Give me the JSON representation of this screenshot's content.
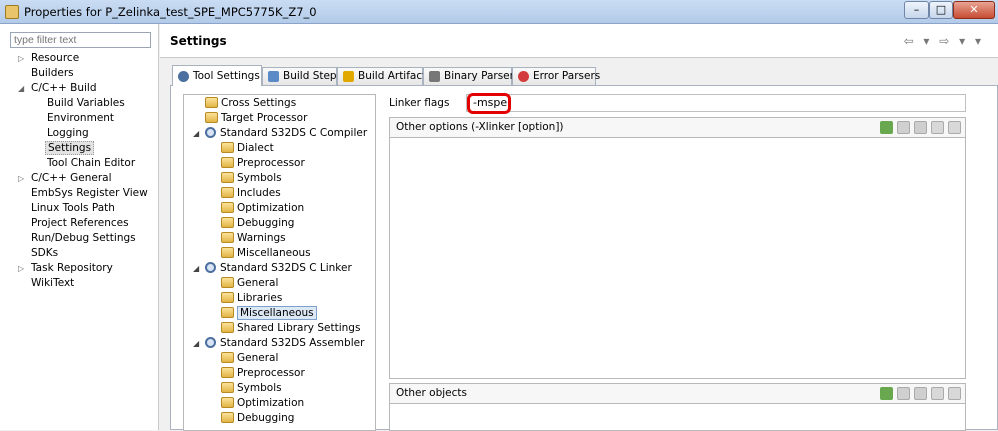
{
  "window": {
    "title": "Properties for P_Zelinka_test_SPE_MPC5775K_Z7_0",
    "min_label": "–",
    "max_label": "□",
    "close_label": "✕"
  },
  "left": {
    "filter_placeholder": "type filter text",
    "items": [
      {
        "label": "Resource",
        "expander": "▷"
      },
      {
        "label": "Builders",
        "expander": ""
      },
      {
        "label": "C/C++ Build",
        "expander": "◢"
      },
      {
        "label": "Build Variables",
        "expander": ""
      },
      {
        "label": "Environment",
        "expander": ""
      },
      {
        "label": "Logging",
        "expander": ""
      },
      {
        "label": "Settings",
        "expander": ""
      },
      {
        "label": "Tool Chain Editor",
        "expander": ""
      },
      {
        "label": "C/C++ General",
        "expander": "▷"
      },
      {
        "label": "EmbSys Register View",
        "expander": ""
      },
      {
        "label": "Linux Tools Path",
        "expander": ""
      },
      {
        "label": "Project References",
        "expander": ""
      },
      {
        "label": "Run/Debug Settings",
        "expander": ""
      },
      {
        "label": "SDKs",
        "expander": ""
      },
      {
        "label": "Task Repository",
        "expander": "▷"
      },
      {
        "label": "WikiText",
        "expander": ""
      }
    ]
  },
  "header": {
    "title": "Settings",
    "nav_icons": "⇦ ▾ ⇨ ▾ ▾"
  },
  "tabs": [
    {
      "label": "Tool Settings",
      "color": "#4b6f9e"
    },
    {
      "label": "Build Steps",
      "color": "#5b8bc7"
    },
    {
      "label": "Build Artifact",
      "color": "#e0a800"
    },
    {
      "label": "Binary Parsers",
      "color": "#777777"
    },
    {
      "label": "Error Parsers",
      "color": "#d23c3c"
    }
  ],
  "tree": [
    {
      "label": "Cross Settings",
      "icon": "folder",
      "expander": ""
    },
    {
      "label": "Target Processor",
      "icon": "folder",
      "expander": ""
    },
    {
      "label": "Standard S32DS C Compiler",
      "icon": "gear",
      "expander": "◢"
    },
    {
      "label": "Dialect",
      "icon": "folder",
      "expander": ""
    },
    {
      "label": "Preprocessor",
      "icon": "folder",
      "expander": ""
    },
    {
      "label": "Symbols",
      "icon": "folder",
      "expander": ""
    },
    {
      "label": "Includes",
      "icon": "folder",
      "expander": ""
    },
    {
      "label": "Optimization",
      "icon": "folder",
      "expander": ""
    },
    {
      "label": "Debugging",
      "icon": "folder",
      "expander": ""
    },
    {
      "label": "Warnings",
      "icon": "folder",
      "expander": ""
    },
    {
      "label": "Miscellaneous",
      "icon": "folder",
      "expander": ""
    },
    {
      "label": "Standard S32DS C Linker",
      "icon": "gear",
      "expander": "◢"
    },
    {
      "label": "General",
      "icon": "folder",
      "expander": ""
    },
    {
      "label": "Libraries",
      "icon": "folder",
      "expander": ""
    },
    {
      "label": "Miscellaneous",
      "icon": "folder",
      "expander": ""
    },
    {
      "label": "Shared Library Settings",
      "icon": "folder",
      "expander": ""
    },
    {
      "label": "Standard S32DS Assembler",
      "icon": "gear",
      "expander": "◢"
    },
    {
      "label": "General",
      "icon": "folder",
      "expander": ""
    },
    {
      "label": "Preprocessor",
      "icon": "folder",
      "expander": ""
    },
    {
      "label": "Symbols",
      "icon": "folder",
      "expander": ""
    },
    {
      "label": "Optimization",
      "icon": "folder",
      "expander": ""
    },
    {
      "label": "Debugging",
      "icon": "folder",
      "expander": ""
    }
  ],
  "settings": {
    "linker_flags_label": "Linker flags",
    "linker_flags_value": "-mspe",
    "other_options_label": "Other options (-Xlinker [option])",
    "other_objects_label": "Other objects"
  }
}
